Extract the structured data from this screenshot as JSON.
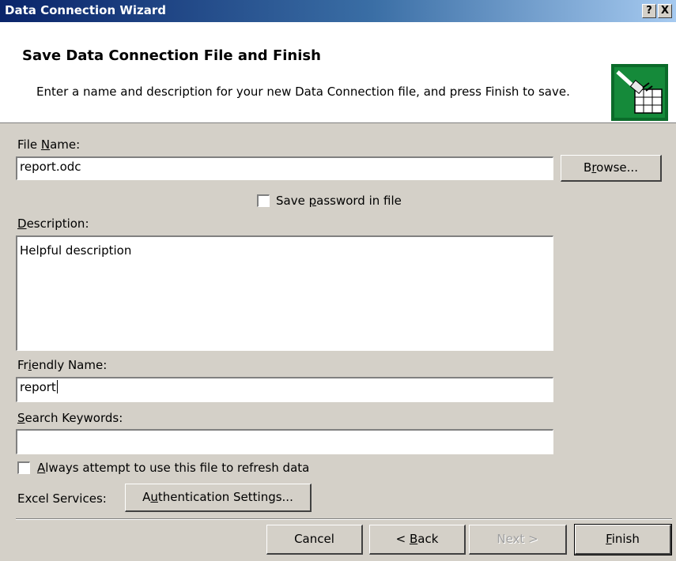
{
  "window": {
    "title": "Data Connection Wizard",
    "help_label": "?",
    "close_label": "X"
  },
  "header": {
    "title": "Save Data Connection File and Finish",
    "description": "Enter a name and description for your new Data Connection file, and press Finish to save.",
    "icon": "data-connection-plug-icon"
  },
  "form": {
    "file_name": {
      "label_pre": "File ",
      "label_key": "N",
      "label_post": "ame:",
      "value": "report.odc"
    },
    "browse": {
      "pre": "B",
      "key": "r",
      "post": "owse..."
    },
    "save_password": {
      "pre": "Save ",
      "key": "p",
      "post": "assword in file",
      "checked": false
    },
    "description": {
      "label_key": "D",
      "label_post": "escription:",
      "value": "Helpful description"
    },
    "friendly_name": {
      "label_pre": "Fr",
      "label_key": "i",
      "label_post": "endly Name:",
      "value": "report"
    },
    "search_keywords": {
      "label_key": "S",
      "label_post": "earch Keywords:",
      "value": ""
    },
    "always_refresh": {
      "key": "A",
      "post": "lways attempt to use this file to refresh data",
      "checked": false
    },
    "excel_services_label": "Excel Services:",
    "auth_settings": {
      "pre": "A",
      "key": "u",
      "post": "thentication Settings..."
    }
  },
  "footer": {
    "cancel": "Cancel",
    "back": {
      "pre": "< ",
      "key": "B",
      "post": "ack"
    },
    "next": "Next >",
    "finish": {
      "key": "F",
      "post": "inish"
    }
  }
}
